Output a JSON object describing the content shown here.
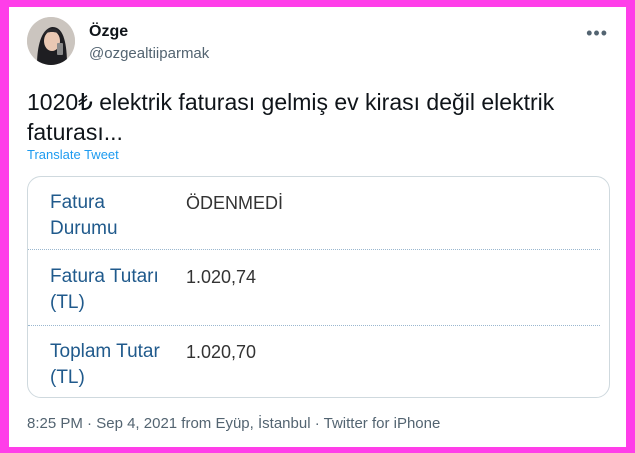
{
  "user": {
    "name": "Özge",
    "handle": "@ozgealtiiparmak"
  },
  "more_icon": "more-options-icon",
  "tweet": {
    "text": "1020₺ elektrik faturası gelmiş ev kirası değil elektrik faturası...",
    "translate_label": "Translate Tweet"
  },
  "invoice": {
    "rows": [
      {
        "label_line1": "Fatura",
        "label_line2": "Durumu",
        "value": "ÖDENMEDİ"
      },
      {
        "label_line1": "Fatura Tutarı",
        "label_line2": "(TL)",
        "value": "1.020,74"
      },
      {
        "label_line1": "Toplam Tutar",
        "label_line2": "(TL)",
        "value": "1.020,70"
      }
    ]
  },
  "meta": {
    "time": "8:25 PM",
    "date": "Sep 4, 2021",
    "location": "from Eyüp, İstanbul",
    "source": "Twitter for iPhone",
    "separator": "·"
  },
  "colors": {
    "frame": "#ff3ee9",
    "link": "#1d9bf0",
    "label_blue": "#205a8c",
    "secondary": "#536471"
  }
}
